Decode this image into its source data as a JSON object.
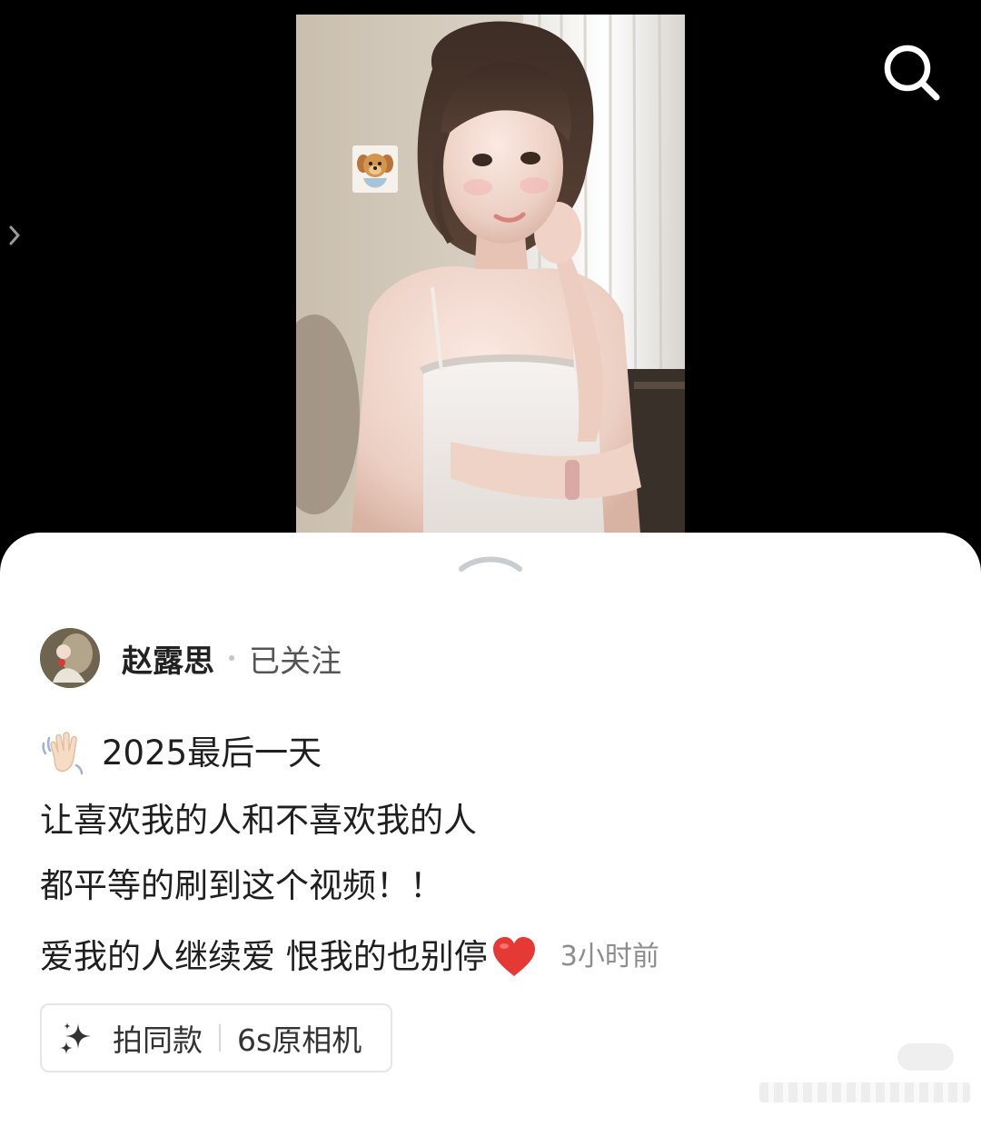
{
  "video": {
    "sticker_icon": "teddy-bear-sticker"
  },
  "top_bar": {
    "search_icon": "search-icon",
    "side_arrow_icon": "chevron-right-icon"
  },
  "post": {
    "author": {
      "name": "赵露思",
      "follow_status": "已关注"
    },
    "caption": {
      "line1_emoji": "waving-hand-icon",
      "line1_text": "2025最后一天",
      "line2": "让喜欢我的人和不喜欢我的人",
      "line3": "都平等的刷到这个视频！！",
      "line4_text": "爱我的人继续爱 恨我的也别停",
      "line4_emoji": "red-heart-icon"
    },
    "time_ago": "3小时前",
    "template_chip": {
      "icon": "sparkle-icon",
      "action_label": "拍同款",
      "template_name": "6s原相机"
    }
  },
  "colors": {
    "accent_heart": "#e53935",
    "sheet_background": "#ffffff",
    "video_background": "#000000"
  }
}
